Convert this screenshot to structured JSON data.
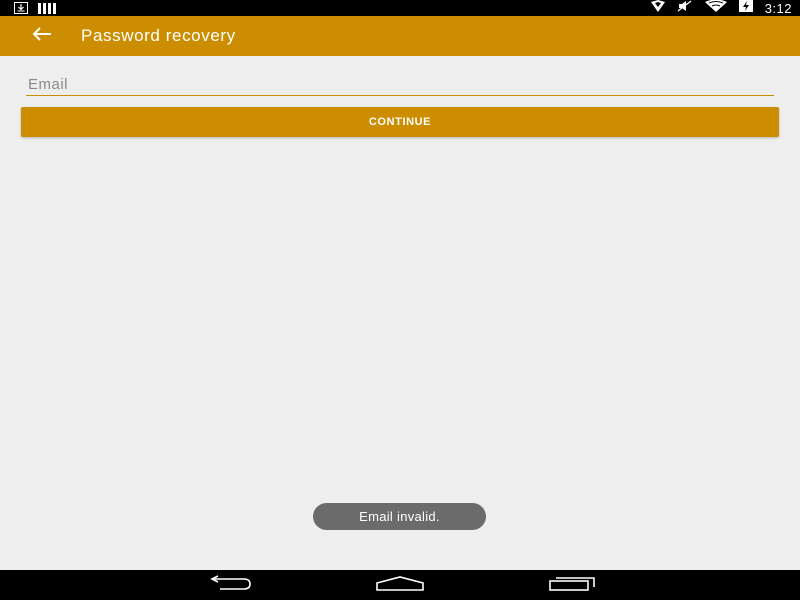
{
  "status_bar": {
    "time": "3:12",
    "left_icons": [
      "download-icon",
      "sim-signal-icon"
    ],
    "right_icons": [
      "location-icon",
      "muted-icon",
      "wifi-icon",
      "battery-charging-icon"
    ]
  },
  "toolbar": {
    "title": "Password recovery",
    "back_icon": "arrow-left-icon",
    "background": "#cc8e00"
  },
  "form": {
    "email_placeholder": "Email",
    "email_value": "",
    "continue_label": "CONTINUE"
  },
  "toast": {
    "message": "Email invalid."
  },
  "nav_bar": {
    "buttons": [
      "back-icon",
      "home-icon",
      "recents-icon"
    ]
  },
  "colors": {
    "accent": "#cc8e00",
    "background": "#eeeeee",
    "toast": "#6b6b6b"
  }
}
